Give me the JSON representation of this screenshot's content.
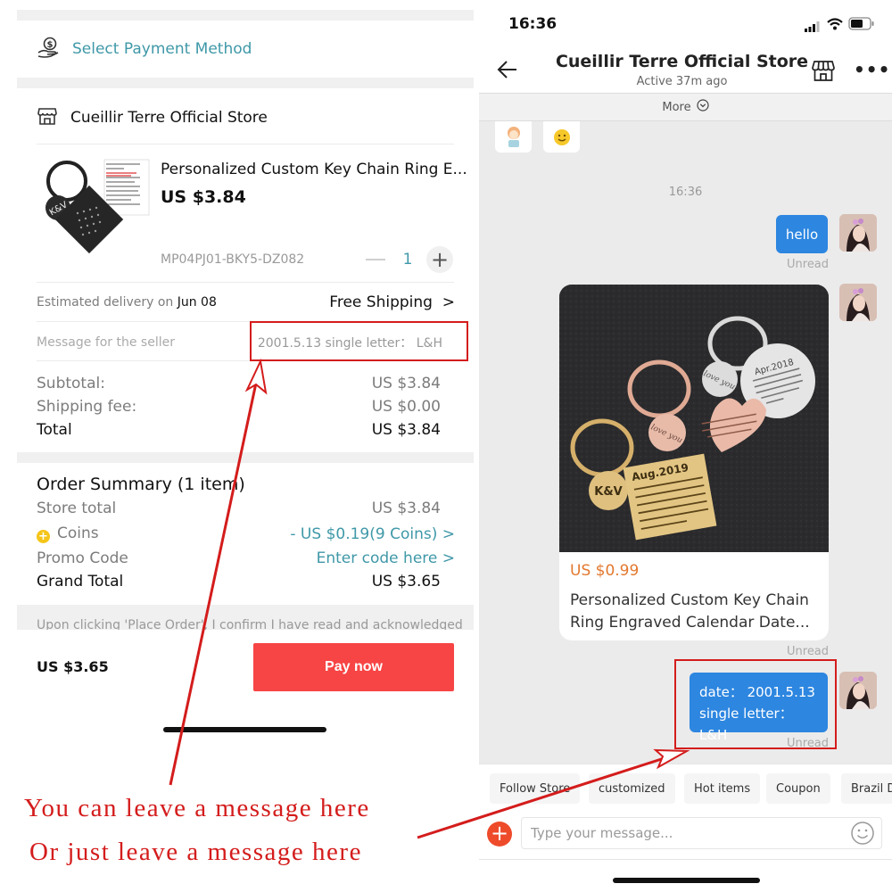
{
  "checkout": {
    "payment_method_label": "Select Payment Method",
    "store_name": "Cueillir Terre Official Store",
    "product": {
      "title": "Personalized Custom Key Chain Ring E...",
      "price": "US $3.84",
      "sku": "MP04PJ01-BKY5-DZ082",
      "quantity": "1"
    },
    "delivery": {
      "label": "Estimated delivery on ",
      "date": "Jun 08",
      "shipping": "Free Shipping",
      "chevron": ">"
    },
    "seller_message": {
      "label": "Message for the seller",
      "value": "2001.5.13 single letter： L&H"
    },
    "totals": [
      {
        "label": "Subtotal:",
        "value": "US $3.84"
      },
      {
        "label": "Shipping fee:",
        "value": "US $0.00"
      },
      {
        "label": "Total",
        "value": "US $3.84"
      }
    ],
    "order_summary": {
      "title": "Order Summary (1 item)",
      "store_total_label": "Store total",
      "store_total_value": "US $3.84",
      "coins_label": "Coins",
      "coins_value": "- US $0.19(9 Coins) >",
      "promo_label": "Promo Code",
      "promo_value": "Enter code here >",
      "grand_total_label": "Grand Total",
      "grand_total_value": "US $3.65"
    },
    "disclaimer": "Upon clicking 'Place Order', I confirm I have read and acknowledged",
    "bottom_total": "US $3.65",
    "pay_button": "Pay now"
  },
  "annotations": {
    "line1": "You can leave a message here",
    "line2": "Or just leave a message here",
    "color": "#d41c1c"
  },
  "chat": {
    "status_time": "16:36",
    "title": "Cueillir Terre Official Store",
    "subtitle": "Active 37m ago",
    "more_label": "More",
    "time_separator": "16:36",
    "messages": [
      {
        "type": "text",
        "text": "hello",
        "status": "Unread"
      },
      {
        "type": "product",
        "price": "US $0.99",
        "title": "Personalized Custom Key Chain Ring Engraved Calendar Date...",
        "status": "Unread"
      },
      {
        "type": "text",
        "line1": "date： 2001.5.13",
        "line2": "single letter： L&H",
        "status": "Unread"
      }
    ],
    "quick_replies": [
      "Follow Store",
      "customized",
      "Hot items",
      "Coupon",
      "Brazil D"
    ],
    "input_placeholder": "Type your message...",
    "product_photo_text": {
      "gold": "Aug.2019",
      "gold_tag": "K&V",
      "rose_tag": "love you",
      "silver": "Apr.2018",
      "silver_tag": "love you"
    },
    "bubble_color": "#2d86e0"
  }
}
